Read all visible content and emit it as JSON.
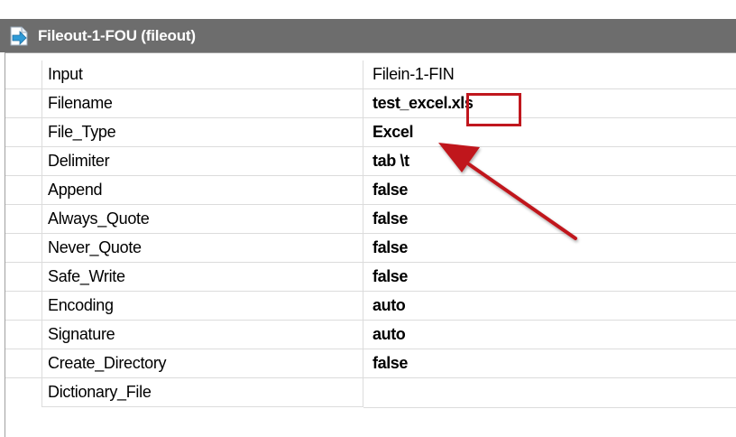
{
  "panel": {
    "title": "Fileout-1-FOU (fileout)",
    "icon": "file-output-arrow-icon"
  },
  "properties": [
    {
      "name": "Input",
      "value": "Filein-1-FIN",
      "bold": false
    },
    {
      "name": "Filename",
      "value": "test_excel.xls",
      "bold": true
    },
    {
      "name": "File_Type",
      "value": "Excel",
      "bold": true
    },
    {
      "name": "Delimiter",
      "value": "tab \\t",
      "bold": true
    },
    {
      "name": "Append",
      "value": "false",
      "bold": true
    },
    {
      "name": "Always_Quote",
      "value": "false",
      "bold": true
    },
    {
      "name": "Never_Quote",
      "value": "false",
      "bold": true
    },
    {
      "name": "Safe_Write",
      "value": "false",
      "bold": true
    },
    {
      "name": "Encoding",
      "value": "auto",
      "bold": true
    },
    {
      "name": "Signature",
      "value": "auto",
      "bold": true
    },
    {
      "name": "Create_Directory",
      "value": "false",
      "bold": true
    },
    {
      "name": "Dictionary_File",
      "value": "",
      "bold": false
    }
  ],
  "annotations": {
    "highlight_color": "#c0171e",
    "arrow_color": "#c0171e"
  },
  "colors": {
    "header_bg": "#6d6d6d",
    "header_text": "#ffffff",
    "grid_lines": "#dcdcdc"
  }
}
